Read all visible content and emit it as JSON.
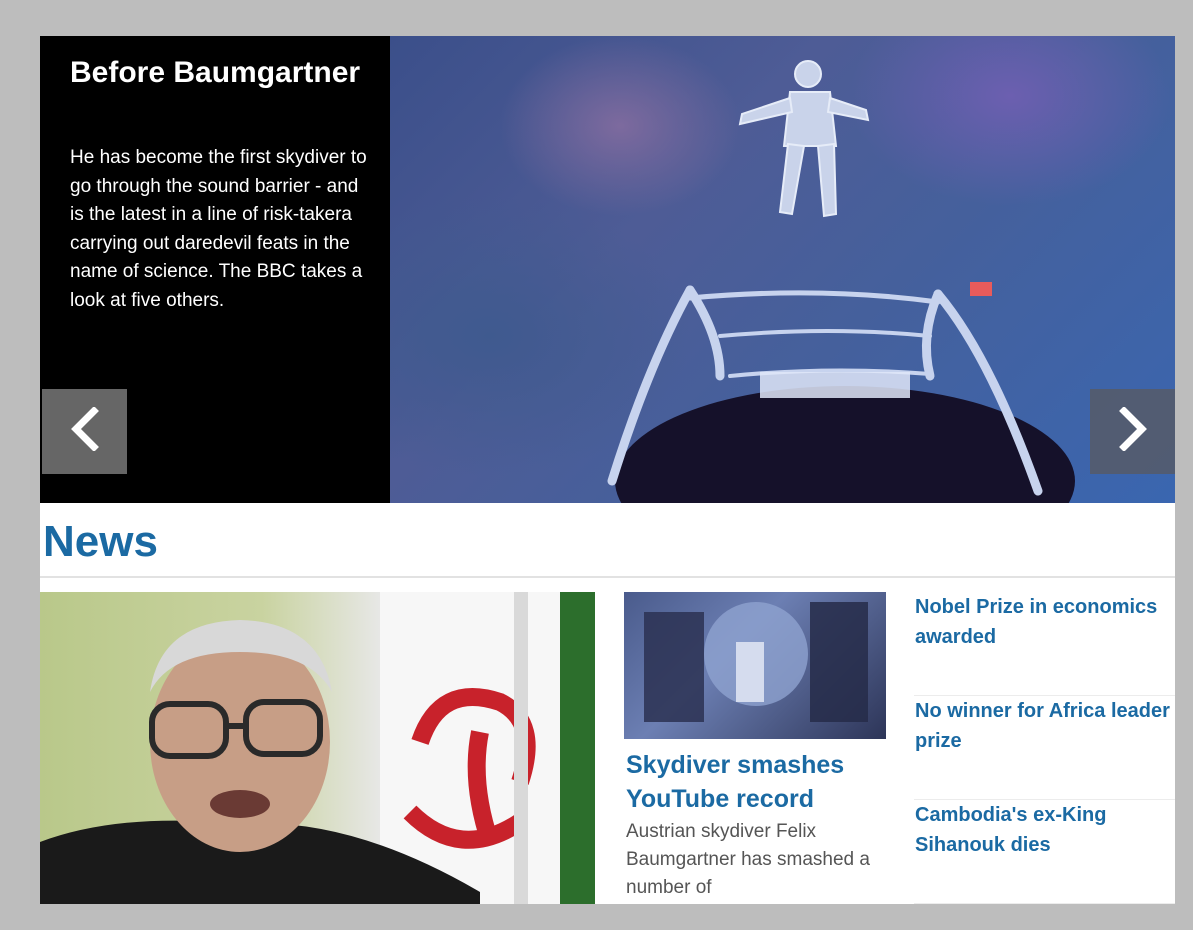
{
  "hero": {
    "title": "Before Baumgartner",
    "description": "He has become the first skydiver to go through the sound barrier - and is the latest in a line of risk-takera carrying out daredevil feats in the name of science. The BBC takes a look at five others."
  },
  "news": {
    "heading": "News",
    "lead_story": {
      "headline": "Skydiver smashes YouTube record",
      "summary": "Austrian skydiver Felix Baumgartner has smashed a number of"
    },
    "side_links": [
      "Nobel Prize in economics awarded",
      "No winner for Africa leader prize",
      "Cambodia's ex-King Sihanouk dies"
    ]
  },
  "icons": {
    "prev": "chevron-left-icon",
    "next": "chevron-right-icon"
  },
  "colors": {
    "accent": "#1b6aa3",
    "hero_bg": "#000000",
    "page_bg": "#bdbdbd"
  }
}
